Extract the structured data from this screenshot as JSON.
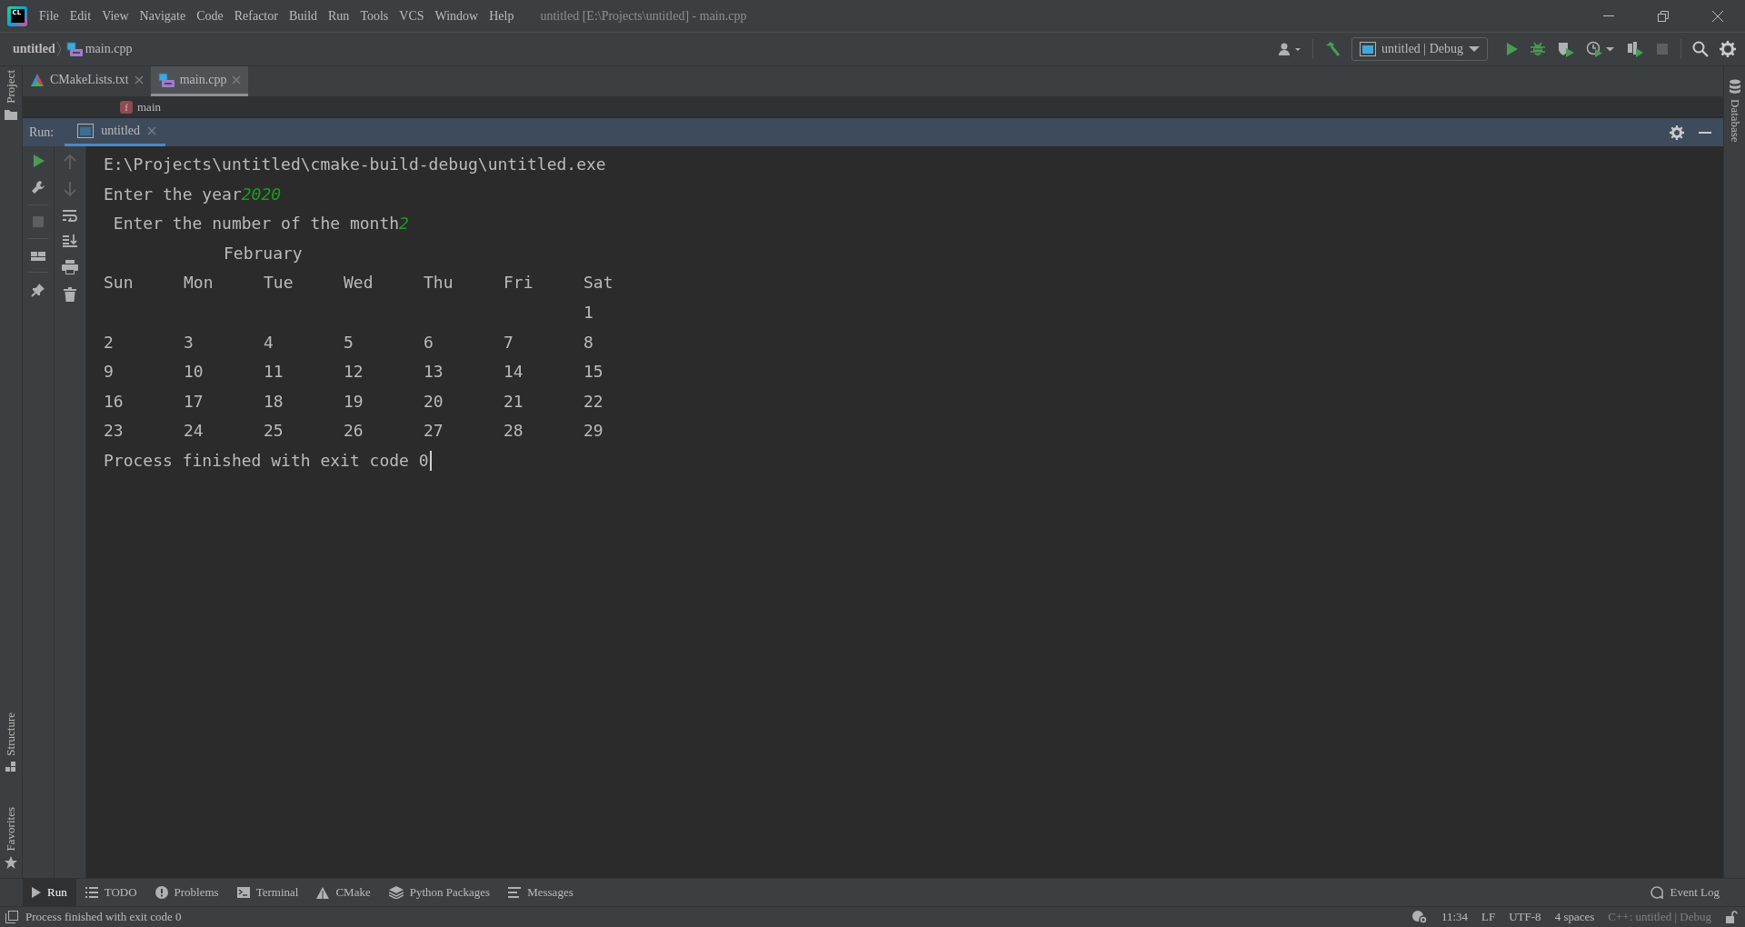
{
  "title_bar": {
    "logo": "CL",
    "menus": [
      "File",
      "Edit",
      "View",
      "Navigate",
      "Code",
      "Refactor",
      "Build",
      "Run",
      "Tools",
      "VCS",
      "Window",
      "Help"
    ],
    "title": "untitled [E:\\Projects\\untitled] - main.cpp"
  },
  "navigation": {
    "project": "untitled",
    "file": "main.cpp",
    "run_config": "untitled | Debug"
  },
  "left_stripe": {
    "top": [
      {
        "label": "Project",
        "kind": "folder"
      }
    ],
    "bottom": [
      {
        "label": "Structure",
        "kind": "structure"
      },
      {
        "label": "Favorites",
        "kind": "star"
      }
    ]
  },
  "right_stripe": [
    {
      "label": "Database"
    }
  ],
  "editor_tabs": [
    {
      "label": "CMakeLists.txt",
      "kind": "cmake",
      "selected": false
    },
    {
      "label": "main.cpp",
      "kind": "cpp",
      "selected": true
    }
  ],
  "breadcrumb": {
    "badge": "f",
    "symbol": "main"
  },
  "run_panel": {
    "title": "Run:",
    "tabs": [
      {
        "label": "untitled",
        "selected": true
      }
    ],
    "console": {
      "command": "E:\\Projects\\untitled\\cmake-build-debug\\untitled.exe",
      "prompts": [
        {
          "text": "Enter the year",
          "input": "2020"
        },
        {
          "text": " Enter the number of the month",
          "input": "2"
        }
      ],
      "month": "February",
      "weekdays": [
        "Sun",
        "Mon",
        "Tue",
        "Wed",
        "Thu",
        "Fri",
        "Sat"
      ],
      "weeks": [
        {
          "sat": "1"
        },
        {
          "sun": "2",
          "mon": "3",
          "tue": "4",
          "wed": "5",
          "thu": "6",
          "fri": "7",
          "sat": "8"
        },
        {
          "sun": "9",
          "mon": "10",
          "tue": "11",
          "wed": "12",
          "thu": "13",
          "fri": "14",
          "sat": "15"
        },
        {
          "sun": "16",
          "mon": "17",
          "tue": "18",
          "wed": "19",
          "thu": "20",
          "fri": "21",
          "sat": "22"
        },
        {
          "sun": "23",
          "mon": "24",
          "tue": "25",
          "wed": "26",
          "thu": "27",
          "fri": "28",
          "sat": "29"
        }
      ],
      "exit_message": "Process finished with exit code 0"
    }
  },
  "tool_windows": [
    {
      "label": "Run",
      "kind": "run",
      "selected": true
    },
    {
      "label": "TODO",
      "kind": "list",
      "selected": false
    },
    {
      "label": "Problems",
      "kind": "problems",
      "selected": false
    },
    {
      "label": "Terminal",
      "kind": "terminal",
      "selected": false
    },
    {
      "label": "CMake",
      "kind": "cmake",
      "selected": false
    },
    {
      "label": "Python Packages",
      "kind": "layers",
      "selected": false
    },
    {
      "label": "Messages",
      "kind": "messages",
      "selected": false
    }
  ],
  "event_log": "Event Log",
  "status_bar": {
    "message": "Process finished with exit code 0",
    "items": [
      "11:34",
      "LF",
      "UTF-8",
      "4 spaces"
    ],
    "context": "C++: untitled | Debug"
  }
}
